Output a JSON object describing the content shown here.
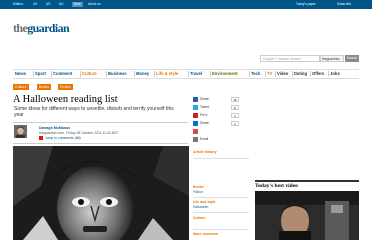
{
  "topbar": {
    "links": [
      "Edition:",
      "UK",
      "US",
      "AU",
      "Beta",
      "About us"
    ],
    "right_links": [
      "Today's paper",
      "Subscribe"
    ]
  },
  "logo": {
    "the": "the",
    "name": "guardian"
  },
  "search": {
    "placeholder": "Google™ Custom Search",
    "scope": "theguardian",
    "button": "Search"
  },
  "nav": {
    "items": [
      {
        "label": "News",
        "color": "#005689"
      },
      {
        "label": "Sport",
        "color": "#005689"
      },
      {
        "label": "Comment",
        "color": "#005689"
      },
      {
        "label": "Culture",
        "color": "#e87600"
      },
      {
        "label": "Business",
        "color": "#005689"
      },
      {
        "label": "Money",
        "color": "#005689"
      },
      {
        "label": "Life & style",
        "color": "#e87600"
      },
      {
        "label": "Travel",
        "color": "#005689"
      },
      {
        "label": "Environment",
        "color": "#4a7801"
      },
      {
        "label": "Tech",
        "color": "#005689"
      },
      {
        "label": "TV",
        "color": "#e87600"
      },
      {
        "label": "Video",
        "color": "#333333"
      },
      {
        "label": "Dating",
        "color": "#333333"
      },
      {
        "label": "Offers",
        "color": "#333333"
      },
      {
        "label": "Jobs",
        "color": "#333333"
      }
    ]
  },
  "breadcrumbs": [
    "Culture",
    "Books",
    "Fiction"
  ],
  "article": {
    "headline": "A Halloween reading list",
    "standfirst": "Some ideas for different ways to unsettle, disturb and terrify yourself this year",
    "author": "Darragh McManus",
    "dateline": "theguardian.com, Friday 28 October 2011 11.30 BST",
    "comments_link": "Jump to comments (68)"
  },
  "share": [
    {
      "label": "Share",
      "icon": "facebook-icon",
      "color": "#3b5998",
      "count": "38"
    },
    {
      "label": "Tweet",
      "icon": "twitter-icon",
      "color": "#29a9e1",
      "count": "31"
    },
    {
      "label": "Pin it",
      "icon": "pinterest-icon",
      "color": "#cb2027",
      "count": "0"
    },
    {
      "label": "Share",
      "icon": "linkedin-icon",
      "color": "#0077b5",
      "count": "2"
    },
    {
      "label": "",
      "icon": "googleplus-icon",
      "color": "#dd4b39",
      "count": ""
    },
    {
      "label": "Email",
      "icon": "email-icon",
      "color": "#777777",
      "count": ""
    }
  ],
  "sidebar": {
    "article_history": "Article history",
    "sections": [
      {
        "title": "Books",
        "links": [
          "Fiction"
        ]
      },
      {
        "title": "Life and style",
        "links": [
          "Halloween"
        ]
      },
      {
        "title": "Culture",
        "links": []
      },
      {
        "title": "More comment",
        "links": []
      }
    ]
  },
  "video": {
    "header": "Today's best video"
  }
}
